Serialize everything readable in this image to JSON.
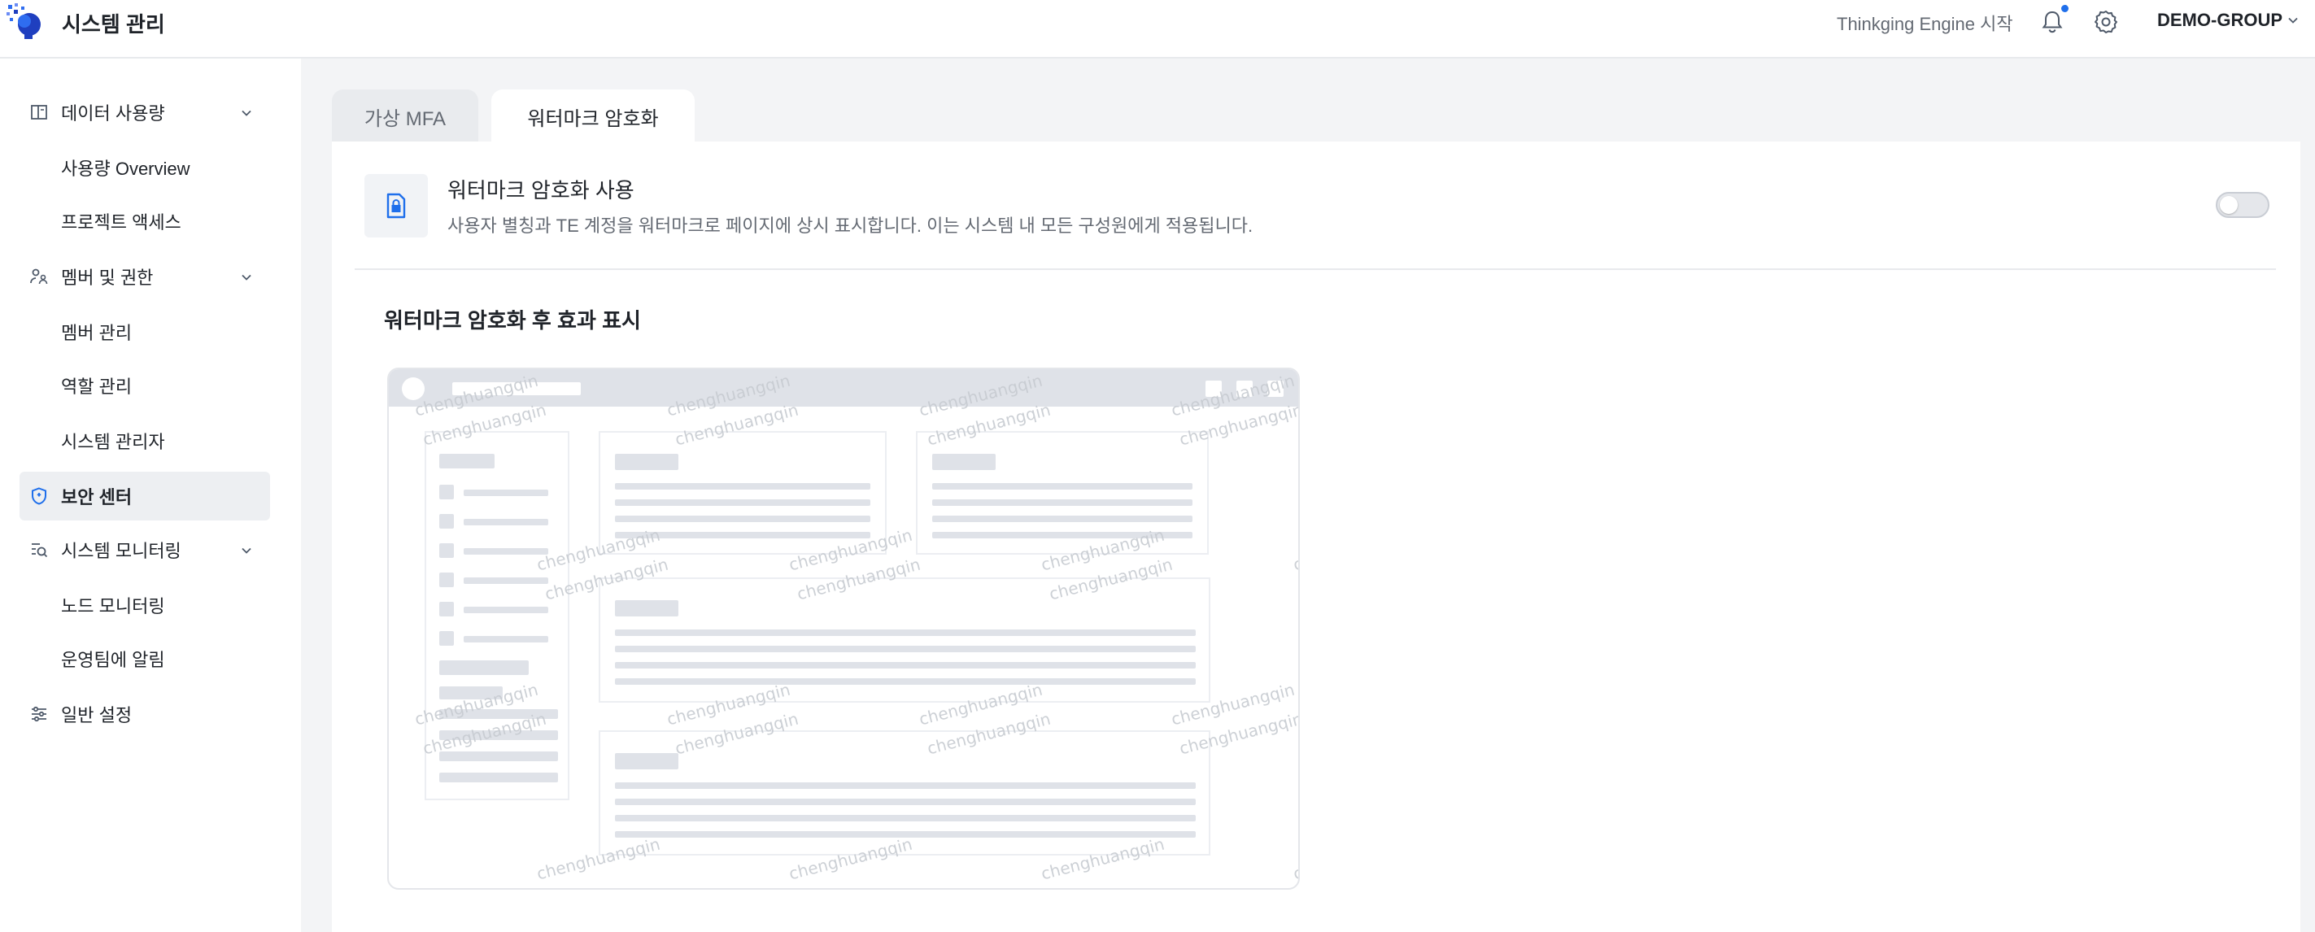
{
  "header": {
    "app_title": "시스템 관리",
    "start_link": "Thinkging Engine 시작",
    "group": "DEMO-GROUP"
  },
  "sidebar": {
    "items": [
      {
        "label": "데이터 사용량",
        "icon": "book-icon",
        "type": "group"
      },
      {
        "label": "사용량 Overview",
        "type": "sub"
      },
      {
        "label": "프로젝트 액세스",
        "type": "sub"
      },
      {
        "label": "멤버 및 권한",
        "icon": "users-icon",
        "type": "group"
      },
      {
        "label": "멤버 관리",
        "type": "sub"
      },
      {
        "label": "역할 관리",
        "type": "sub"
      },
      {
        "label": "시스템 관리자",
        "type": "sub"
      },
      {
        "label": "보안 센터",
        "icon": "shield-icon",
        "type": "item",
        "active": true
      },
      {
        "label": "시스템 모니터링",
        "icon": "monitor-search-icon",
        "type": "group"
      },
      {
        "label": "노드 모니터링",
        "type": "sub"
      },
      {
        "label": "운영팀에 알림",
        "type": "sub"
      },
      {
        "label": "일반 설정",
        "icon": "sliders-icon",
        "type": "item"
      }
    ]
  },
  "tabs": [
    {
      "label": "가상 MFA",
      "active": false
    },
    {
      "label": "워터마크 암호화",
      "active": true
    }
  ],
  "feature": {
    "title": "워터마크 암호화 사용",
    "description": "사용자 별칭과 TE 계정을 워터마크로 페이지에 상시 표시합니다. 이는 시스템 내 모든 구성원에게 적용됩니다.",
    "enabled": false
  },
  "preview": {
    "title": "워터마크 암호화 후 효과 표시",
    "watermark": "chenghuangqin"
  },
  "colors": {
    "accent": "#1f6feb",
    "sidebar_active": "#edeff2",
    "page_bg": "#f3f4f6"
  }
}
